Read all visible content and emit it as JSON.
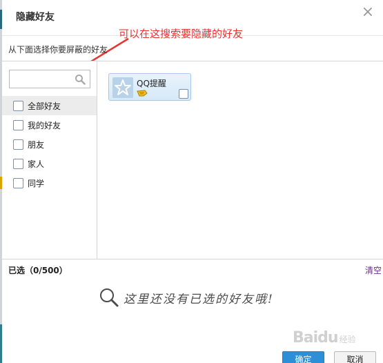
{
  "dialog": {
    "title": "隐藏好友",
    "instruction": "从下面选择你要屏蔽的好友",
    "annotation": "可以在这搜索要隐藏的好友"
  },
  "search": {
    "value": "",
    "placeholder": ""
  },
  "groups": [
    {
      "label": "全部好友",
      "selected": true
    },
    {
      "label": "我的好友",
      "selected": false
    },
    {
      "label": "朋友",
      "selected": false
    },
    {
      "label": "家人",
      "selected": false
    },
    {
      "label": "同学",
      "selected": false
    }
  ],
  "friends": [
    {
      "name": "QQ提醒",
      "icon": "star-icon",
      "badge": "vip-icon"
    }
  ],
  "selection": {
    "count_label": "已选（0/500）",
    "clear_label": "清空",
    "empty_message": "这里还没有已选的好友哦!"
  },
  "buttons": {
    "ok_label": "确定",
    "cancel_label": "取消"
  },
  "watermark": {
    "main": "Baidu",
    "sub": "经验"
  },
  "colors": {
    "annotation_red": "#e8332f",
    "primary_button": "#2d8fd8",
    "link_purple": "#6b2b8c"
  }
}
